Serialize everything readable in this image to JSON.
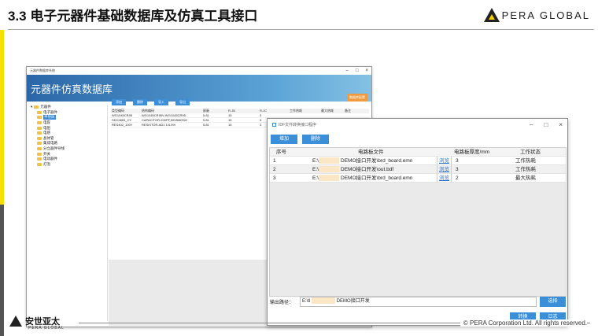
{
  "slide": {
    "title": "3.3 电子元器件基础数据库及仿真工具接口",
    "brand": "PERA GLOBAL",
    "footer_cn": "安世亚太",
    "footer_en": "PERA GLOBAL",
    "copyright": "© PERA Corporation Ltd. All rights reserved."
  },
  "db_window": {
    "titlebar": "元器件数据库系统",
    "controls": [
      "–",
      "□",
      "×"
    ],
    "header_title": "元器件仿真数据库",
    "header_button": "数据库配置",
    "toolbar": [
      "添加",
      "删除",
      "导入",
      "导出"
    ],
    "tree": [
      {
        "label": "元器件",
        "level": 0,
        "selected": false
      },
      {
        "label": "电子器件",
        "level": 1,
        "selected": false
      },
      {
        "label": "半导体",
        "level": 1,
        "selected": true
      },
      {
        "label": "电容",
        "level": 1,
        "selected": false
      },
      {
        "label": "电阻",
        "level": 1,
        "selected": false
      },
      {
        "label": "电感",
        "level": 1,
        "selected": false
      },
      {
        "label": "晶体管",
        "level": 1,
        "selected": false
      },
      {
        "label": "集成电路",
        "level": 1,
        "selected": false
      },
      {
        "label": "分立器件导线",
        "level": 1,
        "selected": false
      },
      {
        "label": "开关",
        "level": 1,
        "selected": false
      },
      {
        "label": "电动器件",
        "level": 1,
        "selected": false
      },
      {
        "label": "灯泡",
        "level": 1,
        "selected": false
      }
    ],
    "columns": [
      "类型编码",
      "结构编码",
      "屏蔽",
      "R-JB",
      "R-JC",
      "工作热耗",
      "最大热耗",
      "备注"
    ],
    "rows": [
      [
        "WG1045CR95",
        "WG1045CR95V-WG1045CR95",
        "5.81",
        "15",
        "3",
        "",
        "",
        ""
      ],
      [
        "SDC0805_CY",
        "CAPACITOR-200PF,50V5MOD8",
        "5.81",
        "15",
        "3",
        "",
        "",
        ""
      ],
      [
        "RES402_100Y",
        "RESISTOR-AD1 1/4.5%",
        "5.81",
        "15",
        "3",
        "",
        "",
        ""
      ]
    ]
  },
  "idf_window": {
    "title": "IDF文件转换接口程序",
    "controls": [
      "–",
      "□",
      "×"
    ],
    "toolbar": {
      "add": "增加",
      "delete": "删除"
    },
    "columns": {
      "index": "序号",
      "file": "电路板文件",
      "thickness": "电路板厚度/mm",
      "state": "工作状态"
    },
    "rows": [
      {
        "index": "1",
        "drive": "E:\\",
        "path": "DEMO接口开发\\brd_board.emn",
        "browse": "浏览",
        "thickness": "3",
        "state": "工作热耗"
      },
      {
        "index": "2",
        "drive": "E:\\",
        "path": "DEMO接口开发\\out.bdf",
        "browse": "浏览",
        "thickness": "3",
        "state": "工作热耗"
      },
      {
        "index": "3",
        "drive": "E:\\",
        "path": "DEMO接口开发\\brd_board.emn",
        "browse": "浏览",
        "thickness": "2",
        "state": "最大热耗"
      }
    ],
    "output_label": "输出路径：",
    "output_drive": "E:\\tl",
    "output_path": "DEMO接口开发",
    "pick_button": "选择",
    "convert_button": "转换",
    "log_button": "日志"
  }
}
